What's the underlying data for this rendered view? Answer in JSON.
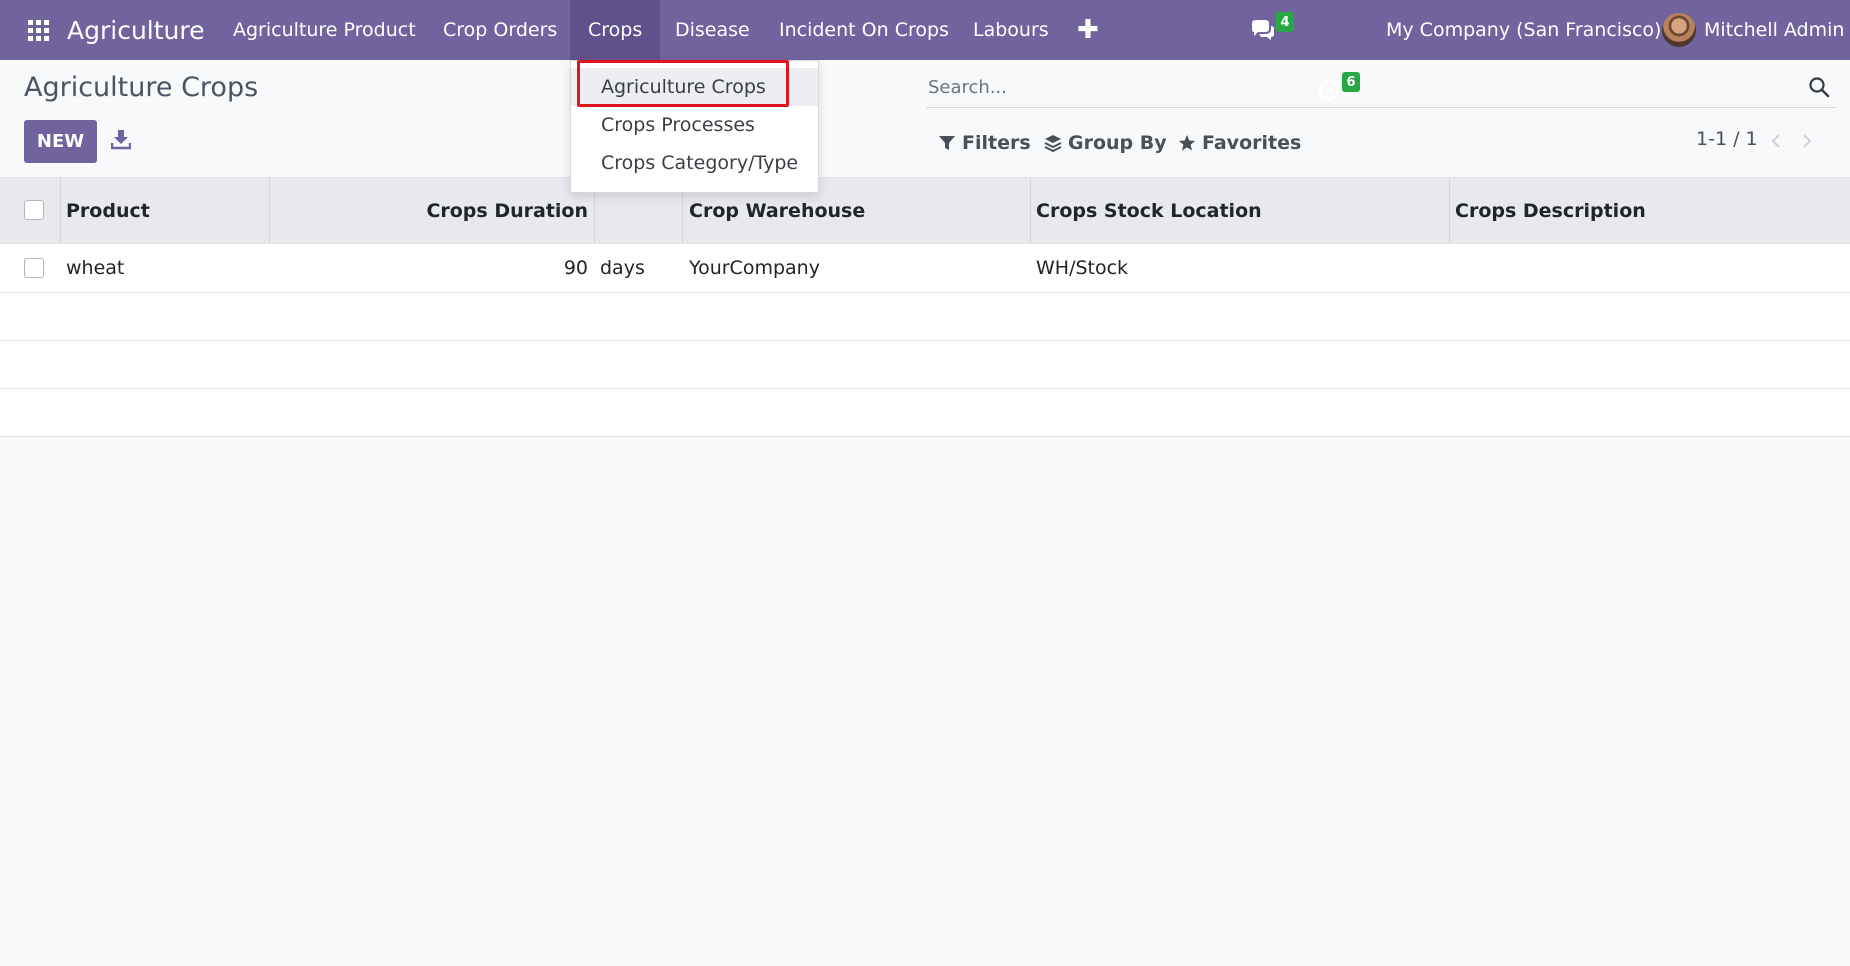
{
  "navbar": {
    "brand": "Agriculture",
    "menu": [
      {
        "label": "Agriculture Product"
      },
      {
        "label": "Crop Orders"
      },
      {
        "label": "Crops"
      },
      {
        "label": "Disease"
      },
      {
        "label": "Incident On Crops"
      },
      {
        "label": "Labours"
      }
    ],
    "active_menu": "Crops",
    "add_icon": "plus-icon",
    "messages_badge": "4",
    "activities_badge": "6",
    "company": "My Company (San Francisco)",
    "user": "Mitchell Admin",
    "colors": {
      "bar": "#71639e",
      "active": "#5f528c",
      "badge": "#28a745"
    }
  },
  "dropdown": {
    "items": [
      {
        "label": "Agriculture Crops"
      },
      {
        "label": "Crops Processes"
      },
      {
        "label": "Crops Category/Type"
      }
    ],
    "highlighted": "Agriculture Crops",
    "highlight_color": "#e0141e"
  },
  "control_panel": {
    "title": "Agriculture Crops",
    "new_label": "NEW",
    "search_placeholder": "Search...",
    "filters_label": "Filters",
    "group_by_label": "Group By",
    "favorites_label": "Favorites",
    "pager": "1-1 / 1"
  },
  "table": {
    "columns": [
      "Product",
      "Crops Duration",
      "Crop Warehouse",
      "Crops Stock Location",
      "Crops Description"
    ],
    "rows": [
      {
        "product": "wheat",
        "duration": "90",
        "duration_unit": "days",
        "warehouse": "YourCompany",
        "location": "WH/Stock",
        "description": ""
      }
    ]
  }
}
